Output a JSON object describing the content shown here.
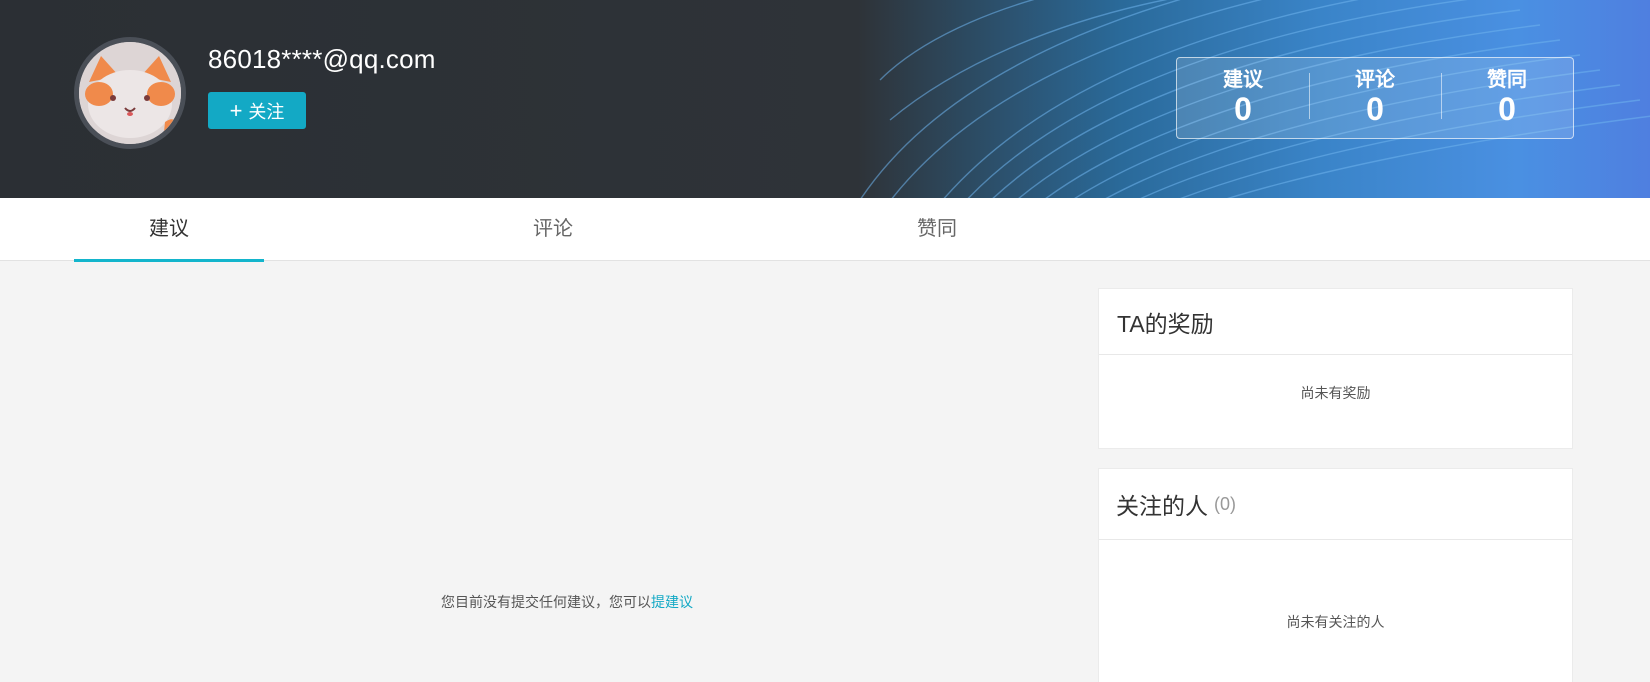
{
  "profile": {
    "username": "86018****@qq.com",
    "follow_label": "关注"
  },
  "stats": [
    {
      "label": "建议",
      "value": "0"
    },
    {
      "label": "评论",
      "value": "0"
    },
    {
      "label": "赞同",
      "value": "0"
    }
  ],
  "tabs": [
    {
      "label": "建议",
      "active": true
    },
    {
      "label": "评论",
      "active": false
    },
    {
      "label": "赞同",
      "active": false
    }
  ],
  "main": {
    "empty_text": "您目前没有提交任何建议，您可以",
    "empty_link": "提建议"
  },
  "rewards": {
    "title": "TA的奖励",
    "empty": "尚未有奖励"
  },
  "following": {
    "title": "关注的人",
    "count": "(0)",
    "empty": "尚未有关注的人"
  },
  "colors": {
    "accent": "#13a9c5",
    "banner_dark": "#2b2f34",
    "banner_blue": "#4a90e2"
  }
}
